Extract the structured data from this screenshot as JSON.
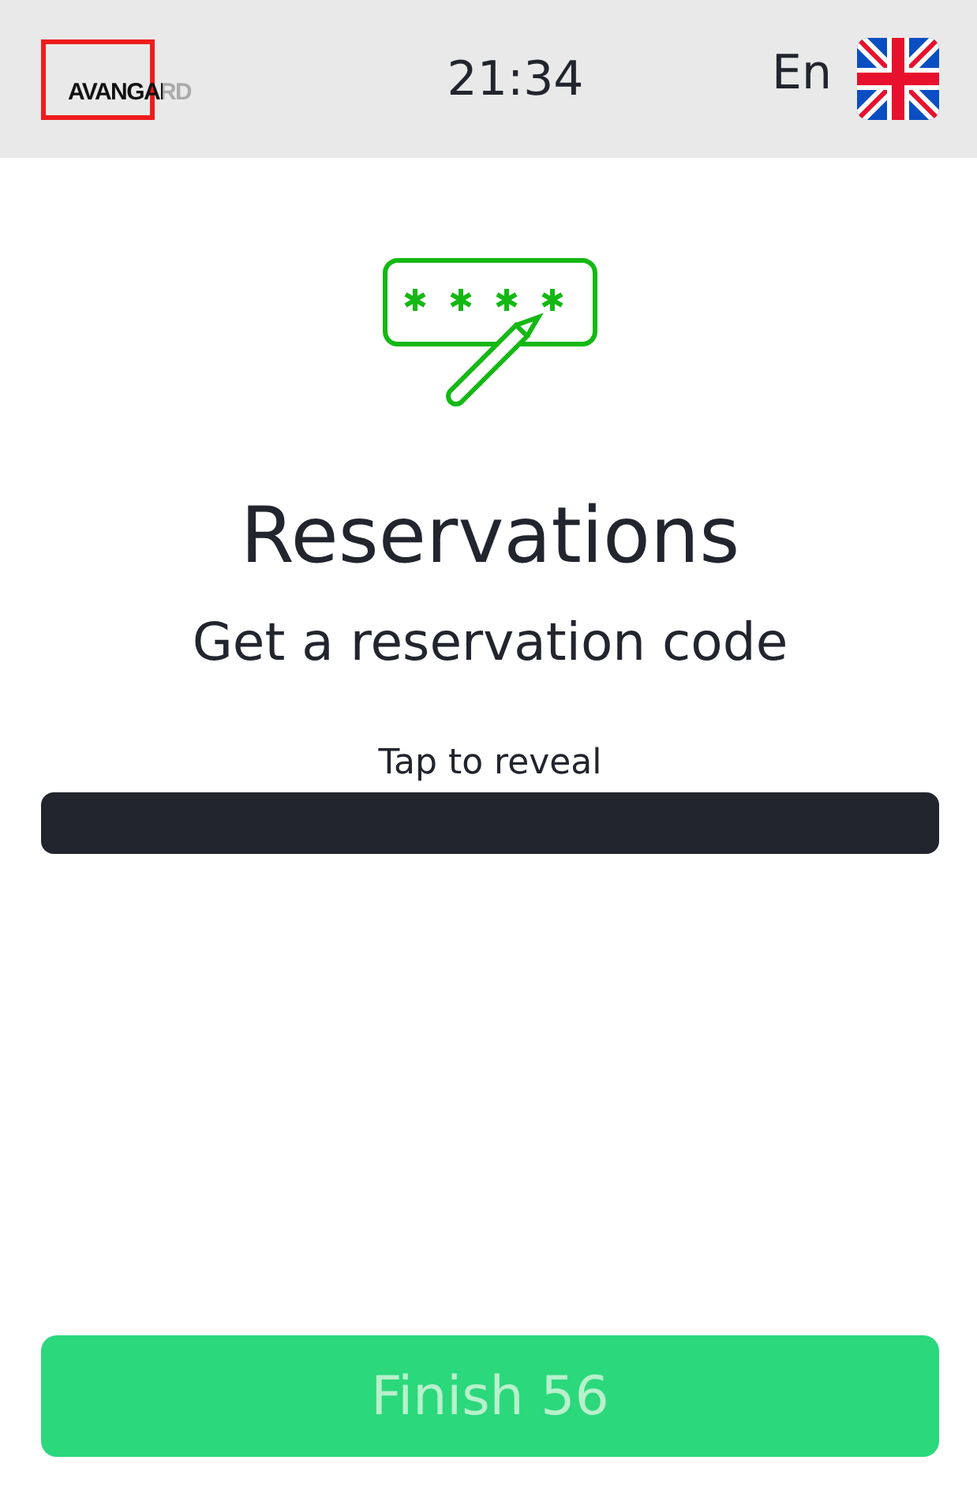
{
  "header": {
    "logo": "AVANGARD",
    "time": "21:34",
    "language": "En"
  },
  "title": "Reservations",
  "subtitle": "Get a reservation code",
  "code": {
    "hint": "Tap to reveal"
  },
  "finish_button": {
    "label": "Finish 56",
    "disabled": true
  }
}
